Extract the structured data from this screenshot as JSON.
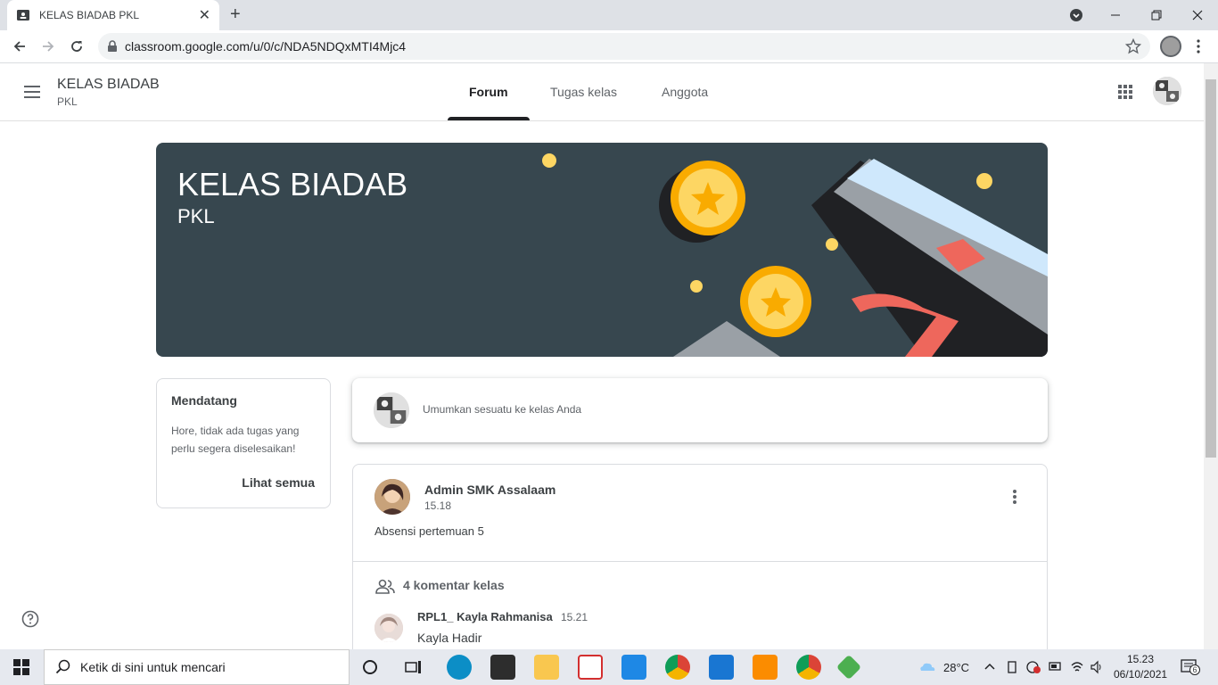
{
  "browser": {
    "tab_title": "KELAS BIADAB PKL",
    "url": "classroom.google.com/u/0/c/NDA5NDQxMTI4Mjc4"
  },
  "header": {
    "class_name": "KELAS BIADAB",
    "section": "PKL",
    "tabs": [
      {
        "label": "Forum",
        "active": true
      },
      {
        "label": "Tugas kelas",
        "active": false
      },
      {
        "label": "Anggota",
        "active": false
      }
    ]
  },
  "banner": {
    "title": "KELAS BIADAB",
    "subtitle": "PKL",
    "bg_color": "#37474f"
  },
  "upcoming": {
    "title": "Mendatang",
    "message": "Hore, tidak ada tugas yang perlu segera diselesaikan!",
    "see_all": "Lihat semua"
  },
  "announce": {
    "placeholder": "Umumkan sesuatu ke kelas Anda"
  },
  "post": {
    "author": "Admin SMK Assalaam",
    "time": "15.18",
    "body": "Absensi pertemuan 5",
    "comment_count": "4 komentar kelas",
    "comment": {
      "author": "RPL1_ Kayla Rahmanisa",
      "time": "15.21",
      "text": "Kayla Hadir"
    }
  },
  "taskbar": {
    "search_placeholder": "Ketik di sini untuk mencari",
    "temperature": "28°C",
    "time": "15.23",
    "date": "06/10/2021",
    "notification_count": "6"
  },
  "icons": [
    "classroom-favicon",
    "close-icon",
    "plus-icon",
    "back-icon",
    "forward-icon",
    "reload-icon",
    "lock-icon",
    "star-icon",
    "menu-icon",
    "apps-grid-icon",
    "more-vert-icon",
    "people-icon",
    "help-icon",
    "windows-icon",
    "search-icon"
  ]
}
